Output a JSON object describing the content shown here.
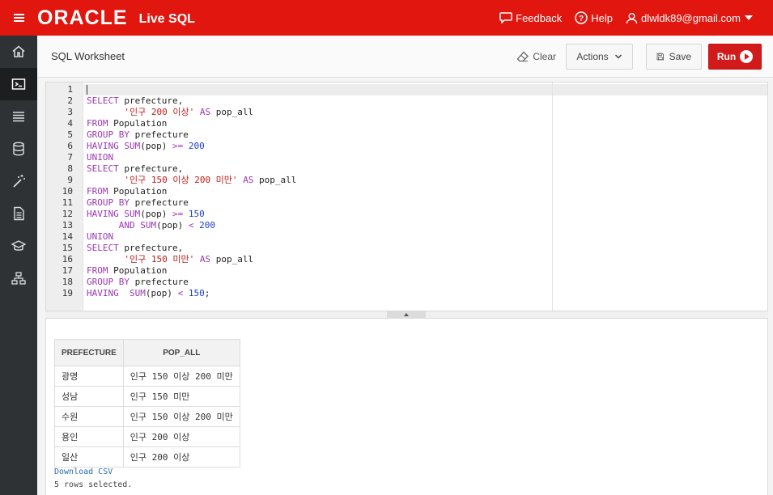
{
  "header": {
    "brand": "ORACLE",
    "product": "Live SQL",
    "feedback": "Feedback",
    "help": "Help",
    "user": "dlwldk89@gmail.com"
  },
  "sidebar": {
    "items": [
      {
        "name": "home-icon"
      },
      {
        "name": "sql-worksheet-icon",
        "active": true
      },
      {
        "name": "list-icon"
      },
      {
        "name": "database-icon"
      },
      {
        "name": "wand-icon"
      },
      {
        "name": "document-icon"
      },
      {
        "name": "education-icon"
      },
      {
        "name": "schema-icon"
      }
    ]
  },
  "worksheet": {
    "title": "SQL Worksheet",
    "clear_label": "Clear",
    "actions_label": "Actions",
    "save_label": "Save",
    "run_label": "Run"
  },
  "editor": {
    "lines": [
      "",
      "SELECT prefecture,",
      "       '인구 200 이상' AS pop_all",
      "FROM Population",
      "GROUP BY prefecture",
      "HAVING SUM(pop) >= 200",
      "UNION",
      "SELECT prefecture,",
      "       '인구 150 이상 200 미만' AS pop_all",
      "FROM Population",
      "GROUP BY prefecture",
      "HAVING SUM(pop) >= 150",
      "      AND SUM(pop) < 200",
      "UNION",
      "SELECT prefecture,",
      "       '인구 150 미만' AS pop_all",
      "FROM Population",
      "GROUP BY prefecture",
      "HAVING  SUM(pop) < 150;"
    ]
  },
  "results": {
    "columns": [
      "PREFECTURE",
      "POP_ALL"
    ],
    "rows": [
      [
        "광명",
        "인구 150 이상 200 미만"
      ],
      [
        "성남",
        "인구 150 미만"
      ],
      [
        "수원",
        "인구 150 이상 200 미만"
      ],
      [
        "용인",
        "인구 200 이상"
      ],
      [
        "일산",
        "인구 200 이상"
      ]
    ],
    "download_label": "Download CSV",
    "rows_selected": "5 rows selected."
  },
  "colors": {
    "brand_red": "#e0160f",
    "run_red": "#d21a1a",
    "sidebar": "#2f3235",
    "keyword": "#9b37b5",
    "string": "#c41a16",
    "number": "#1a3fcc"
  }
}
